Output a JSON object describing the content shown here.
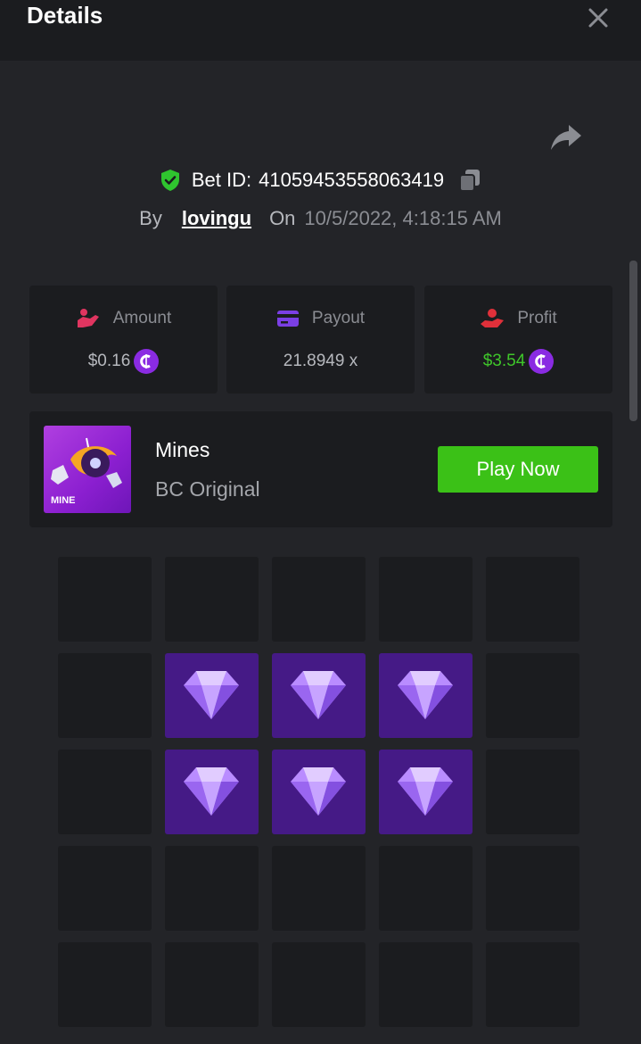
{
  "header": {
    "title": "Details"
  },
  "bet": {
    "id_label": "Bet ID:",
    "id": "41059453558063419",
    "by_label": "By",
    "user": "lovingu",
    "on_label": "On",
    "date": "10/5/2022, 4:18:15 AM"
  },
  "stats": {
    "amount": {
      "label": "Amount",
      "value": "$0.16"
    },
    "payout": {
      "label": "Payout",
      "value": "21.8949 x"
    },
    "profit": {
      "label": "Profit",
      "value": "$3.54"
    }
  },
  "game": {
    "name": "Mines",
    "subtitle": "BC Original",
    "thumb_label": "MINE",
    "play_label": "Play Now"
  },
  "board": {
    "rows": 5,
    "cols": 5,
    "cells": [
      "hidden",
      "hidden",
      "hidden",
      "hidden",
      "hidden",
      "hidden",
      "gem",
      "gem",
      "gem",
      "hidden",
      "hidden",
      "gem",
      "gem",
      "gem",
      "hidden",
      "hidden",
      "hidden",
      "hidden",
      "hidden",
      "hidden",
      "hidden",
      "hidden",
      "hidden",
      "hidden",
      "hidden"
    ]
  },
  "colors": {
    "accent_green": "#3bc117",
    "profit_green": "#3fc62a",
    "coin_purple": "#8a2be2",
    "gem_tile": "#451a86",
    "verified_shield": "#2fc52f"
  },
  "icons": {
    "close": "close-icon",
    "share": "share-icon",
    "shield": "verified-shield-icon",
    "copy": "copy-icon",
    "amount": "amount-hand-icon",
    "payout": "wallet-card-icon",
    "profit": "profit-hand-icon",
    "coin": "bc-coin-icon",
    "gem": "gem-icon"
  }
}
